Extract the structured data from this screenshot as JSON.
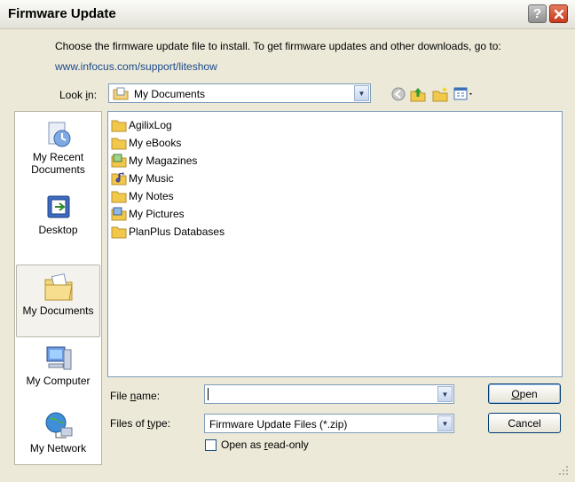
{
  "window": {
    "title": "Firmware Update",
    "help_label": "?",
    "close_label": "✕"
  },
  "intro": {
    "text": "Choose the firmware update file to install. To get firmware updates and other downloads, go to:",
    "link": "www.infocus.com/support/liteshow"
  },
  "look_in": {
    "label": "Look in:",
    "value": "My Documents"
  },
  "toolbar_icons": [
    "back-arrow-icon",
    "up-folder-icon",
    "new-folder-icon",
    "views-menu-icon"
  ],
  "places": [
    {
      "label": "My Recent Documents",
      "icon": "recent-documents-icon"
    },
    {
      "label": "Desktop",
      "icon": "desktop-icon"
    },
    {
      "label": "My Documents",
      "icon": "my-documents-icon",
      "selected": true
    },
    {
      "label": "My Computer",
      "icon": "my-computer-icon"
    },
    {
      "label": "My Network",
      "icon": "my-network-icon"
    }
  ],
  "files": [
    {
      "name": "AgilixLog",
      "icon": "folder-icon"
    },
    {
      "name": "My eBooks",
      "icon": "folder-icon"
    },
    {
      "name": "My Magazines",
      "icon": "pictures-folder-icon"
    },
    {
      "name": "My Music",
      "icon": "music-folder-icon"
    },
    {
      "name": "My Notes",
      "icon": "folder-icon"
    },
    {
      "name": "My Pictures",
      "icon": "pictures-folder-icon"
    },
    {
      "name": "PlanPlus Databases",
      "icon": "folder-icon"
    }
  ],
  "file_name": {
    "label": "File name:",
    "value": ""
  },
  "file_type": {
    "label": "Files of type:",
    "value": "Firmware Update Files (*.zip)"
  },
  "read_only": {
    "label": "Open as read-only",
    "checked": false
  },
  "buttons": {
    "open": "Open",
    "cancel": "Cancel"
  },
  "colors": {
    "link": "#1a4a8a",
    "window_bg": "#ece9d8",
    "close_red": "#c63a1e"
  }
}
